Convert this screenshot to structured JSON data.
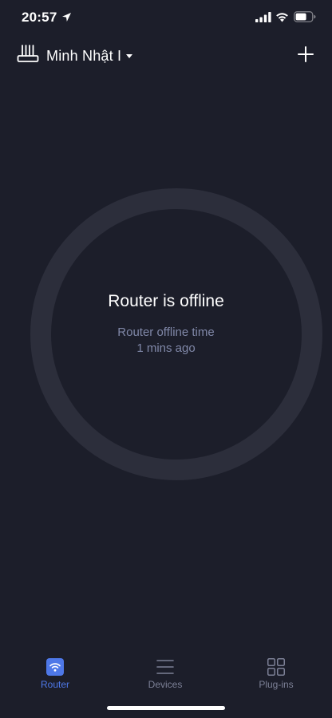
{
  "status_bar": {
    "time": "20:57",
    "icons": [
      "location-arrow-icon",
      "cellular-signal-icon",
      "wifi-icon",
      "battery-icon"
    ]
  },
  "header": {
    "router_name": "Minh Nhật I",
    "router_icon": "router-icon",
    "add_icon": "plus-icon"
  },
  "status": {
    "title": "Router is offline",
    "offline_label": "Router offline time",
    "offline_value": "1 mins ago"
  },
  "tabs": [
    {
      "label": "Router",
      "icon": "router-wifi-icon",
      "active": true
    },
    {
      "label": "Devices",
      "icon": "list-icon",
      "active": false
    },
    {
      "label": "Plug-ins",
      "icon": "grid-icon",
      "active": false
    }
  ],
  "colors": {
    "background": "#1c1e2a",
    "ring": "#2c2e3b",
    "accent": "#4e78e8",
    "muted_text": "#8088a8",
    "tab_inactive": "#7c8096"
  }
}
